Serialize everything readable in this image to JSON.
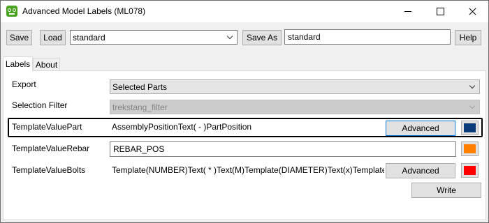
{
  "window": {
    "title": "Advanced Model Labels (ML078)",
    "app_icon": "app-logo-icon"
  },
  "toolbar": {
    "save_label": "Save",
    "load_label": "Load",
    "preset_value": "standard",
    "save_as_label": "Save As",
    "save_as_value": "standard",
    "help_label": "Help"
  },
  "tabs": [
    {
      "label": "Labels",
      "active": true
    },
    {
      "label": "About",
      "active": false
    }
  ],
  "form": {
    "export": {
      "label": "Export",
      "value": "Selected Parts"
    },
    "selection_filter": {
      "label": "Selection Filter",
      "value": "trekstang_filter"
    },
    "part": {
      "label": "TemplateValuePart",
      "value": "AssemblyPositionText( - )PartPosition",
      "advanced_label": "Advanced",
      "color": "#0a3d7a"
    },
    "rebar": {
      "label": "TemplateValueRebar",
      "value": "REBAR_POS",
      "color": "#ff7f00"
    },
    "bolts": {
      "label": "TemplateValueBolts",
      "value": "Template(NUMBER)Text( * )Text(M)Template(DIAMETER)Text(x)Template(LENGT",
      "advanced_label": "Advanced",
      "color": "#ff0000"
    },
    "write_label": "Write"
  }
}
